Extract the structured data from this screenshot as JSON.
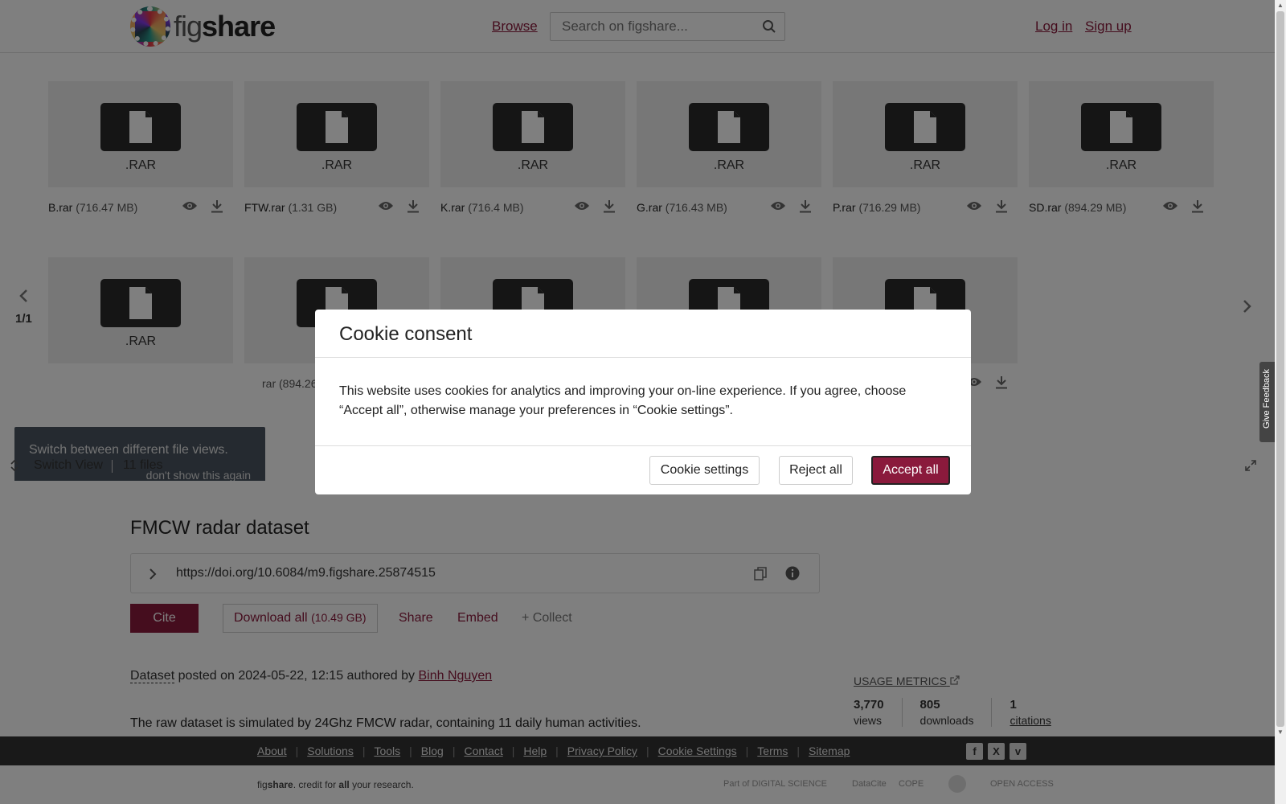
{
  "header": {
    "logo_prefix": "fig",
    "logo_suffix": "share",
    "browse": "Browse",
    "search_placeholder": "Search on figshare...",
    "login": "Log in",
    "signup": "Sign up"
  },
  "viewer": {
    "files": [
      {
        "ext": ".RAR",
        "name": "B.rar",
        "size": "(716.47 MB)"
      },
      {
        "ext": ".RAR",
        "name": "FTW.rar",
        "size": "(1.31 GB)"
      },
      {
        "ext": ".RAR",
        "name": "K.rar",
        "size": "(716.4 MB)"
      },
      {
        "ext": ".RAR",
        "name": "G.rar",
        "size": "(716.43 MB)"
      },
      {
        "ext": ".RAR",
        "name": "P.rar",
        "size": "(716.29 MB)"
      },
      {
        "ext": ".RAR",
        "name": "SD.rar",
        "size": "(894.29 MB)"
      },
      {
        "ext": ".RAR",
        "name": "",
        "size": ""
      },
      {
        "ext": "",
        "name": "",
        "size": "rar (894.26"
      },
      {
        "ext": "",
        "name": "",
        "size": ""
      },
      {
        "ext": "",
        "name": "",
        "size": ""
      },
      {
        "ext": "",
        "name": "",
        "size": ""
      }
    ],
    "pager": "1/1",
    "tooltip_text": "Switch between different file views.",
    "tooltip_dismiss": "don't show this again",
    "switch_view": "Switch View",
    "files_count": "11 files"
  },
  "article": {
    "title": "FMCW radar dataset",
    "doi": "https://doi.org/10.6084/m9.figshare.25874515",
    "cite": "Cite",
    "download_all": "Download all",
    "download_size": "(10.49 GB)",
    "share": "Share",
    "embed": "Embed",
    "collect": "+ Collect",
    "dataset_type": "Dataset",
    "posted_text": "posted on 2024-05-22, 12:15 authored by",
    "author": "Binh Nguyen",
    "description": "The raw dataset is simulated by 24Ghz FMCW radar, containing 11 daily human activities."
  },
  "metrics": {
    "title": "USAGE METRICS",
    "views_num": "3,770",
    "views_label": "views",
    "downloads_num": "805",
    "downloads_label": "downloads",
    "citations_num": "1",
    "citations_label": "citations"
  },
  "footer": {
    "links": [
      "About",
      "Solutions",
      "Tools",
      "Blog",
      "Contact",
      "Help",
      "Privacy Policy",
      "Cookie Settings",
      "Terms",
      "Sitemap"
    ],
    "social": [
      "f",
      "X",
      "v"
    ],
    "tagline_fig": "fig",
    "tagline_share": "share",
    "tagline_rest1": ". credit for ",
    "tagline_all": "all",
    "tagline_rest2": " your research.",
    "partners": [
      "Part of DIGITAL SCIENCE",
      "DataCite",
      "COPE",
      "",
      "OPEN ACCESS"
    ]
  },
  "feedback": "Give Feedback",
  "cookie_modal": {
    "title": "Cookie consent",
    "body": "This website uses cookies for analytics and improving your on-line experience. If you agree, choose “Accept all”, otherwise manage your preferences in “Cookie settings”.",
    "settings": "Cookie settings",
    "reject": "Reject all",
    "accept": "Accept all"
  },
  "colors": {
    "brand": "#8a1a3c",
    "overlay": "rgba(0,0,0,0.5)",
    "footer_bg": "#333333"
  }
}
